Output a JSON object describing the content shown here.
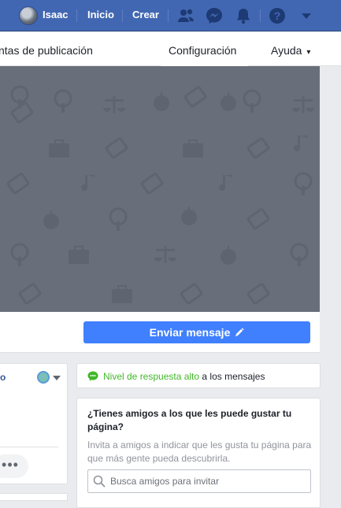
{
  "topbar": {
    "user_name": "Isaac",
    "home_label": "Inicio",
    "create_label": "Crear",
    "icons": [
      "friends-icon",
      "messenger-icon",
      "notifications-icon",
      "help-icon",
      "caret-down-icon"
    ]
  },
  "subnav": {
    "items": [
      "ntas de publicación",
      "Configuración",
      "Ayuda"
    ],
    "help_caret": "▾"
  },
  "cover": {
    "send_button_label": "Enviar mensaje"
  },
  "left_card": {
    "title": "o",
    "more_label": "•••"
  },
  "response": {
    "highlight": "Nivel de respuesta alto",
    "rest": " a los mensajes"
  },
  "invite": {
    "title": "¿Tienes amigos a los que les puede gustar tu página?",
    "description": "Invita a amigos a indicar que les gusta tu página para que más gente pueda descubrirla.",
    "search_placeholder": "Busca amigos para invitar"
  },
  "colors": {
    "brand_blue": "#4267b2",
    "button_blue": "#4080ff",
    "cover_gray": "#686e7a",
    "response_green": "#42b72a"
  }
}
